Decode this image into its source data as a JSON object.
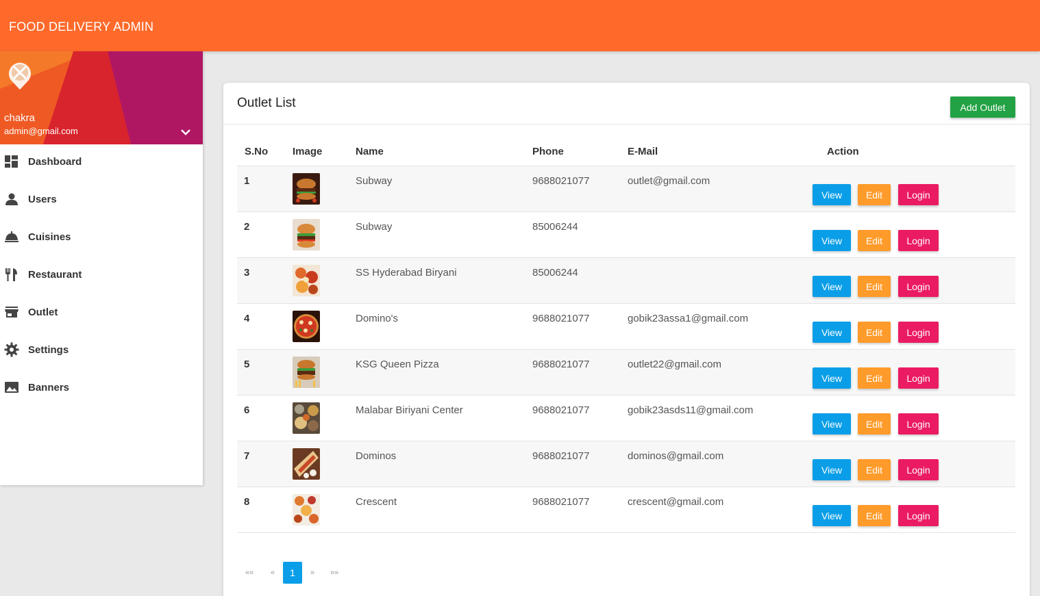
{
  "app": {
    "title": "FOOD DELIVERY ADMIN"
  },
  "user": {
    "name": "chakra",
    "email": "admin@gmail.com"
  },
  "sidebar": {
    "items": [
      {
        "label": "Dashboard",
        "icon": "dashboard-icon"
      },
      {
        "label": "Users",
        "icon": "person-icon"
      },
      {
        "label": "Cuisines",
        "icon": "cloche-icon"
      },
      {
        "label": "Restaurant",
        "icon": "fork-knife-icon"
      },
      {
        "label": "Outlet",
        "icon": "store-icon"
      },
      {
        "label": "Settings",
        "icon": "gear-icon"
      },
      {
        "label": "Banners",
        "icon": "image-icon"
      }
    ]
  },
  "main": {
    "title": "Outlet List",
    "add_button": "Add Outlet",
    "columns": [
      "S.No",
      "Image",
      "Name",
      "Phone",
      "E-Mail",
      "Action"
    ],
    "rows": [
      {
        "sno": "1",
        "name": "Subway",
        "phone": "9688021077",
        "email": "outlet@gmail.com",
        "image": "burger-photo"
      },
      {
        "sno": "2",
        "name": "Subway",
        "phone": "85006244",
        "email": "",
        "image": "burger-photo"
      },
      {
        "sno": "3",
        "name": "SS Hyderabad Biryani",
        "phone": "85006244",
        "email": "",
        "image": "food-platter-photo"
      },
      {
        "sno": "4",
        "name": "Domino's",
        "phone": "9688021077",
        "email": "gobik23assa1@gmail.com",
        "image": "pizza-photo"
      },
      {
        "sno": "5",
        "name": "KSG Queen Pizza",
        "phone": "9688021077",
        "email": "outlet22@gmail.com",
        "image": "burger-fries-photo"
      },
      {
        "sno": "6",
        "name": "Malabar Biriyani Center",
        "phone": "9688021077",
        "email": "gobik23asds11@gmail.com",
        "image": "biryani-photo"
      },
      {
        "sno": "7",
        "name": "Dominos",
        "phone": "9688021077",
        "email": "dominos@gmail.com",
        "image": "wrap-photo"
      },
      {
        "sno": "8",
        "name": "Crescent",
        "phone": "9688021077",
        "email": "crescent@gmail.com",
        "image": "dishes-photo"
      }
    ],
    "actions": {
      "view": "View",
      "edit": "Edit",
      "login": "Login"
    },
    "pagination": {
      "first": "««",
      "prev": "«",
      "current": "1",
      "next": "»",
      "last": "»»"
    }
  },
  "colors": {
    "topbar": "#ff6a2b",
    "add": "#22a244",
    "view": "#0a9ee8",
    "edit": "#ff9b2a",
    "login": "#ea1b63"
  }
}
